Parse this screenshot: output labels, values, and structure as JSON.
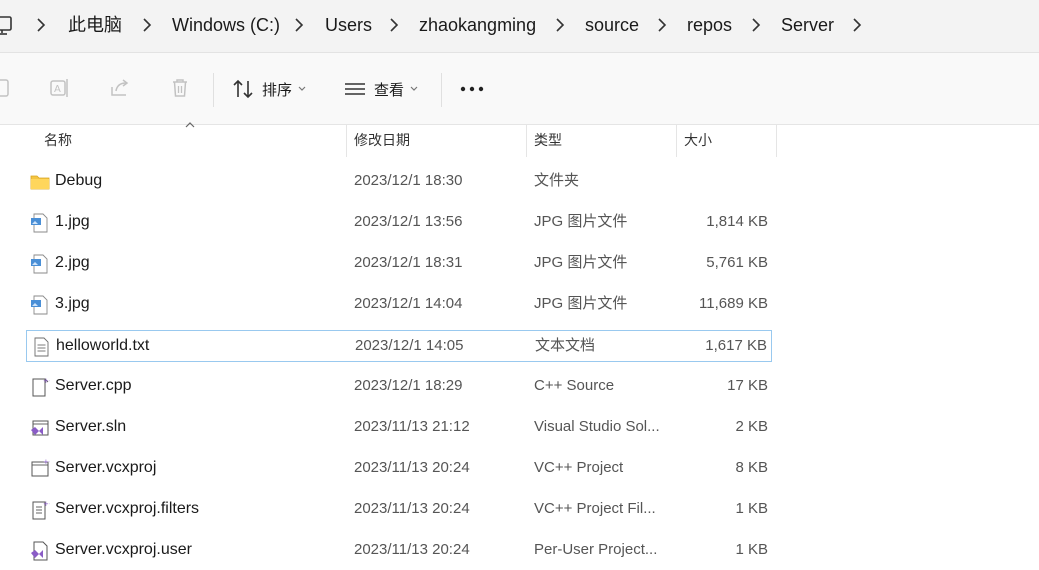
{
  "breadcrumbs": [
    "此电脑",
    "Windows (C:)",
    "Users",
    "zhaokangming",
    "source",
    "repos",
    "Server"
  ],
  "toolbar": {
    "sort_label": "排序",
    "view_label": "查看",
    "more_label": "•••"
  },
  "columns": {
    "name": "名称",
    "date": "修改日期",
    "type": "类型",
    "size": "大小"
  },
  "files": [
    {
      "name": "Debug",
      "date": "2023/12/1 18:30",
      "type": "文件夹",
      "size": "",
      "icon": "folder-icon"
    },
    {
      "name": "1.jpg",
      "date": "2023/12/1 13:56",
      "type": "JPG 图片文件",
      "size": "1,814 KB",
      "icon": "image-file-icon"
    },
    {
      "name": "2.jpg",
      "date": "2023/12/1 18:31",
      "type": "JPG 图片文件",
      "size": "5,761 KB",
      "icon": "image-file-icon"
    },
    {
      "name": "3.jpg",
      "date": "2023/12/1 14:04",
      "type": "JPG 图片文件",
      "size": "11,689 KB",
      "icon": "image-file-icon"
    },
    {
      "name": "helloworld.txt",
      "date": "2023/12/1 14:05",
      "type": "文本文档",
      "size": "1,617 KB",
      "icon": "text-file-icon",
      "selected": true
    },
    {
      "name": "Server.cpp",
      "date": "2023/12/1 18:29",
      "type": "C++ Source",
      "size": "17 KB",
      "icon": "cpp-file-icon"
    },
    {
      "name": "Server.sln",
      "date": "2023/11/13 21:12",
      "type": "Visual Studio Sol...",
      "size": "2 KB",
      "icon": "solution-file-icon"
    },
    {
      "name": "Server.vcxproj",
      "date": "2023/11/13 20:24",
      "type": "VC++ Project",
      "size": "8 KB",
      "icon": "vcxproj-file-icon"
    },
    {
      "name": "Server.vcxproj.filters",
      "date": "2023/11/13 20:24",
      "type": "VC++ Project Fil...",
      "size": "1 KB",
      "icon": "filters-file-icon"
    },
    {
      "name": "Server.vcxproj.user",
      "date": "2023/11/13 20:24",
      "type": "Per-User Project...",
      "size": "1 KB",
      "icon": "user-file-icon"
    }
  ],
  "colors": {
    "selection_border": "#99c9ef",
    "folder": "#f4c542",
    "image_blue": "#4a8fd6",
    "vs_purple": "#8a5cc6"
  }
}
